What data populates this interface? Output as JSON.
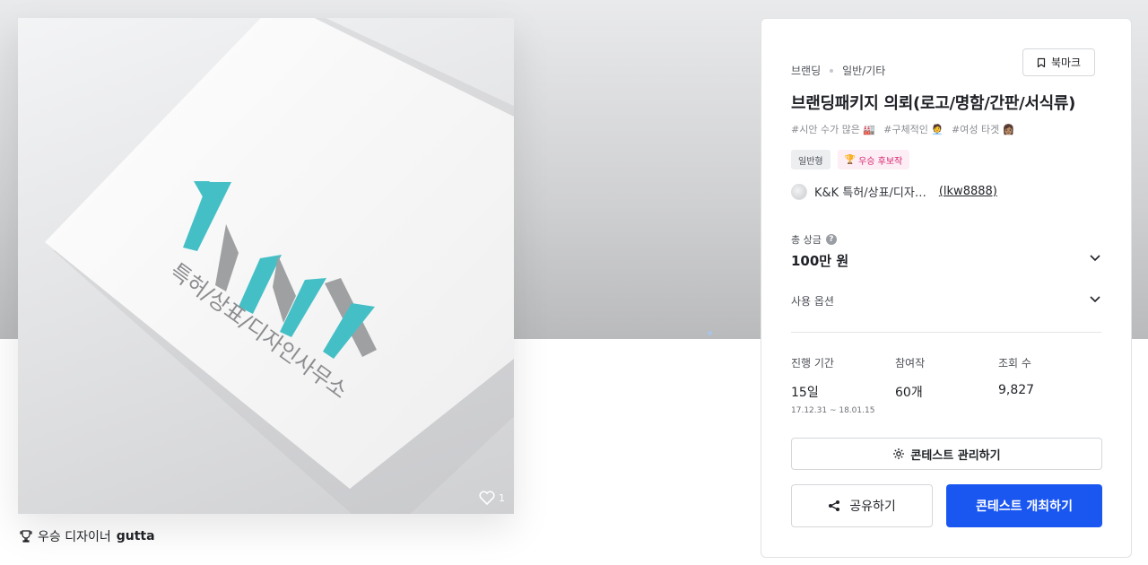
{
  "hero": {
    "logo_text": "K&K",
    "logo_tagline": "특허/상표/디자인사무소",
    "like_count": "1"
  },
  "designer": {
    "prefix": "우승 디자이너",
    "name": "gutta"
  },
  "contest": {
    "category": "브랜딩",
    "subcategory": "일반/기타",
    "bookmark_label": "북마크",
    "title": "브랜딩패키지 의뢰(로고/명함/간판/서식류)",
    "tags": [
      "#시안 수가 많은 🏭",
      "#구체적인 🧑‍💼",
      "#여성 타겟 👩🏽"
    ],
    "badges": {
      "type": "일반형",
      "winner": "우승 후보작"
    },
    "host_name": "K&K 특허/상표/디자…",
    "host_id": "(lkw8888)"
  },
  "prize": {
    "label": "총 상금",
    "help_icon": "?",
    "value": "100만 원"
  },
  "options": {
    "label": "사용 옵션"
  },
  "stats": {
    "period_label": "진행 기간",
    "period_value": "15일",
    "period_dates": "17.12.31 ~ 18.01.15",
    "entries_label": "참여작",
    "entries_value": "60개",
    "views_label": "조회 수",
    "views_value": "9,827"
  },
  "actions": {
    "manage": "콘테스트 관리하기",
    "share": "공유하기",
    "host": "콘테스트 개최하기"
  },
  "colors": {
    "primary": "#1a56f0",
    "logo_teal": "#45bfc6",
    "logo_gray": "#9fa0a2",
    "winner_pink": "#d6246e"
  }
}
